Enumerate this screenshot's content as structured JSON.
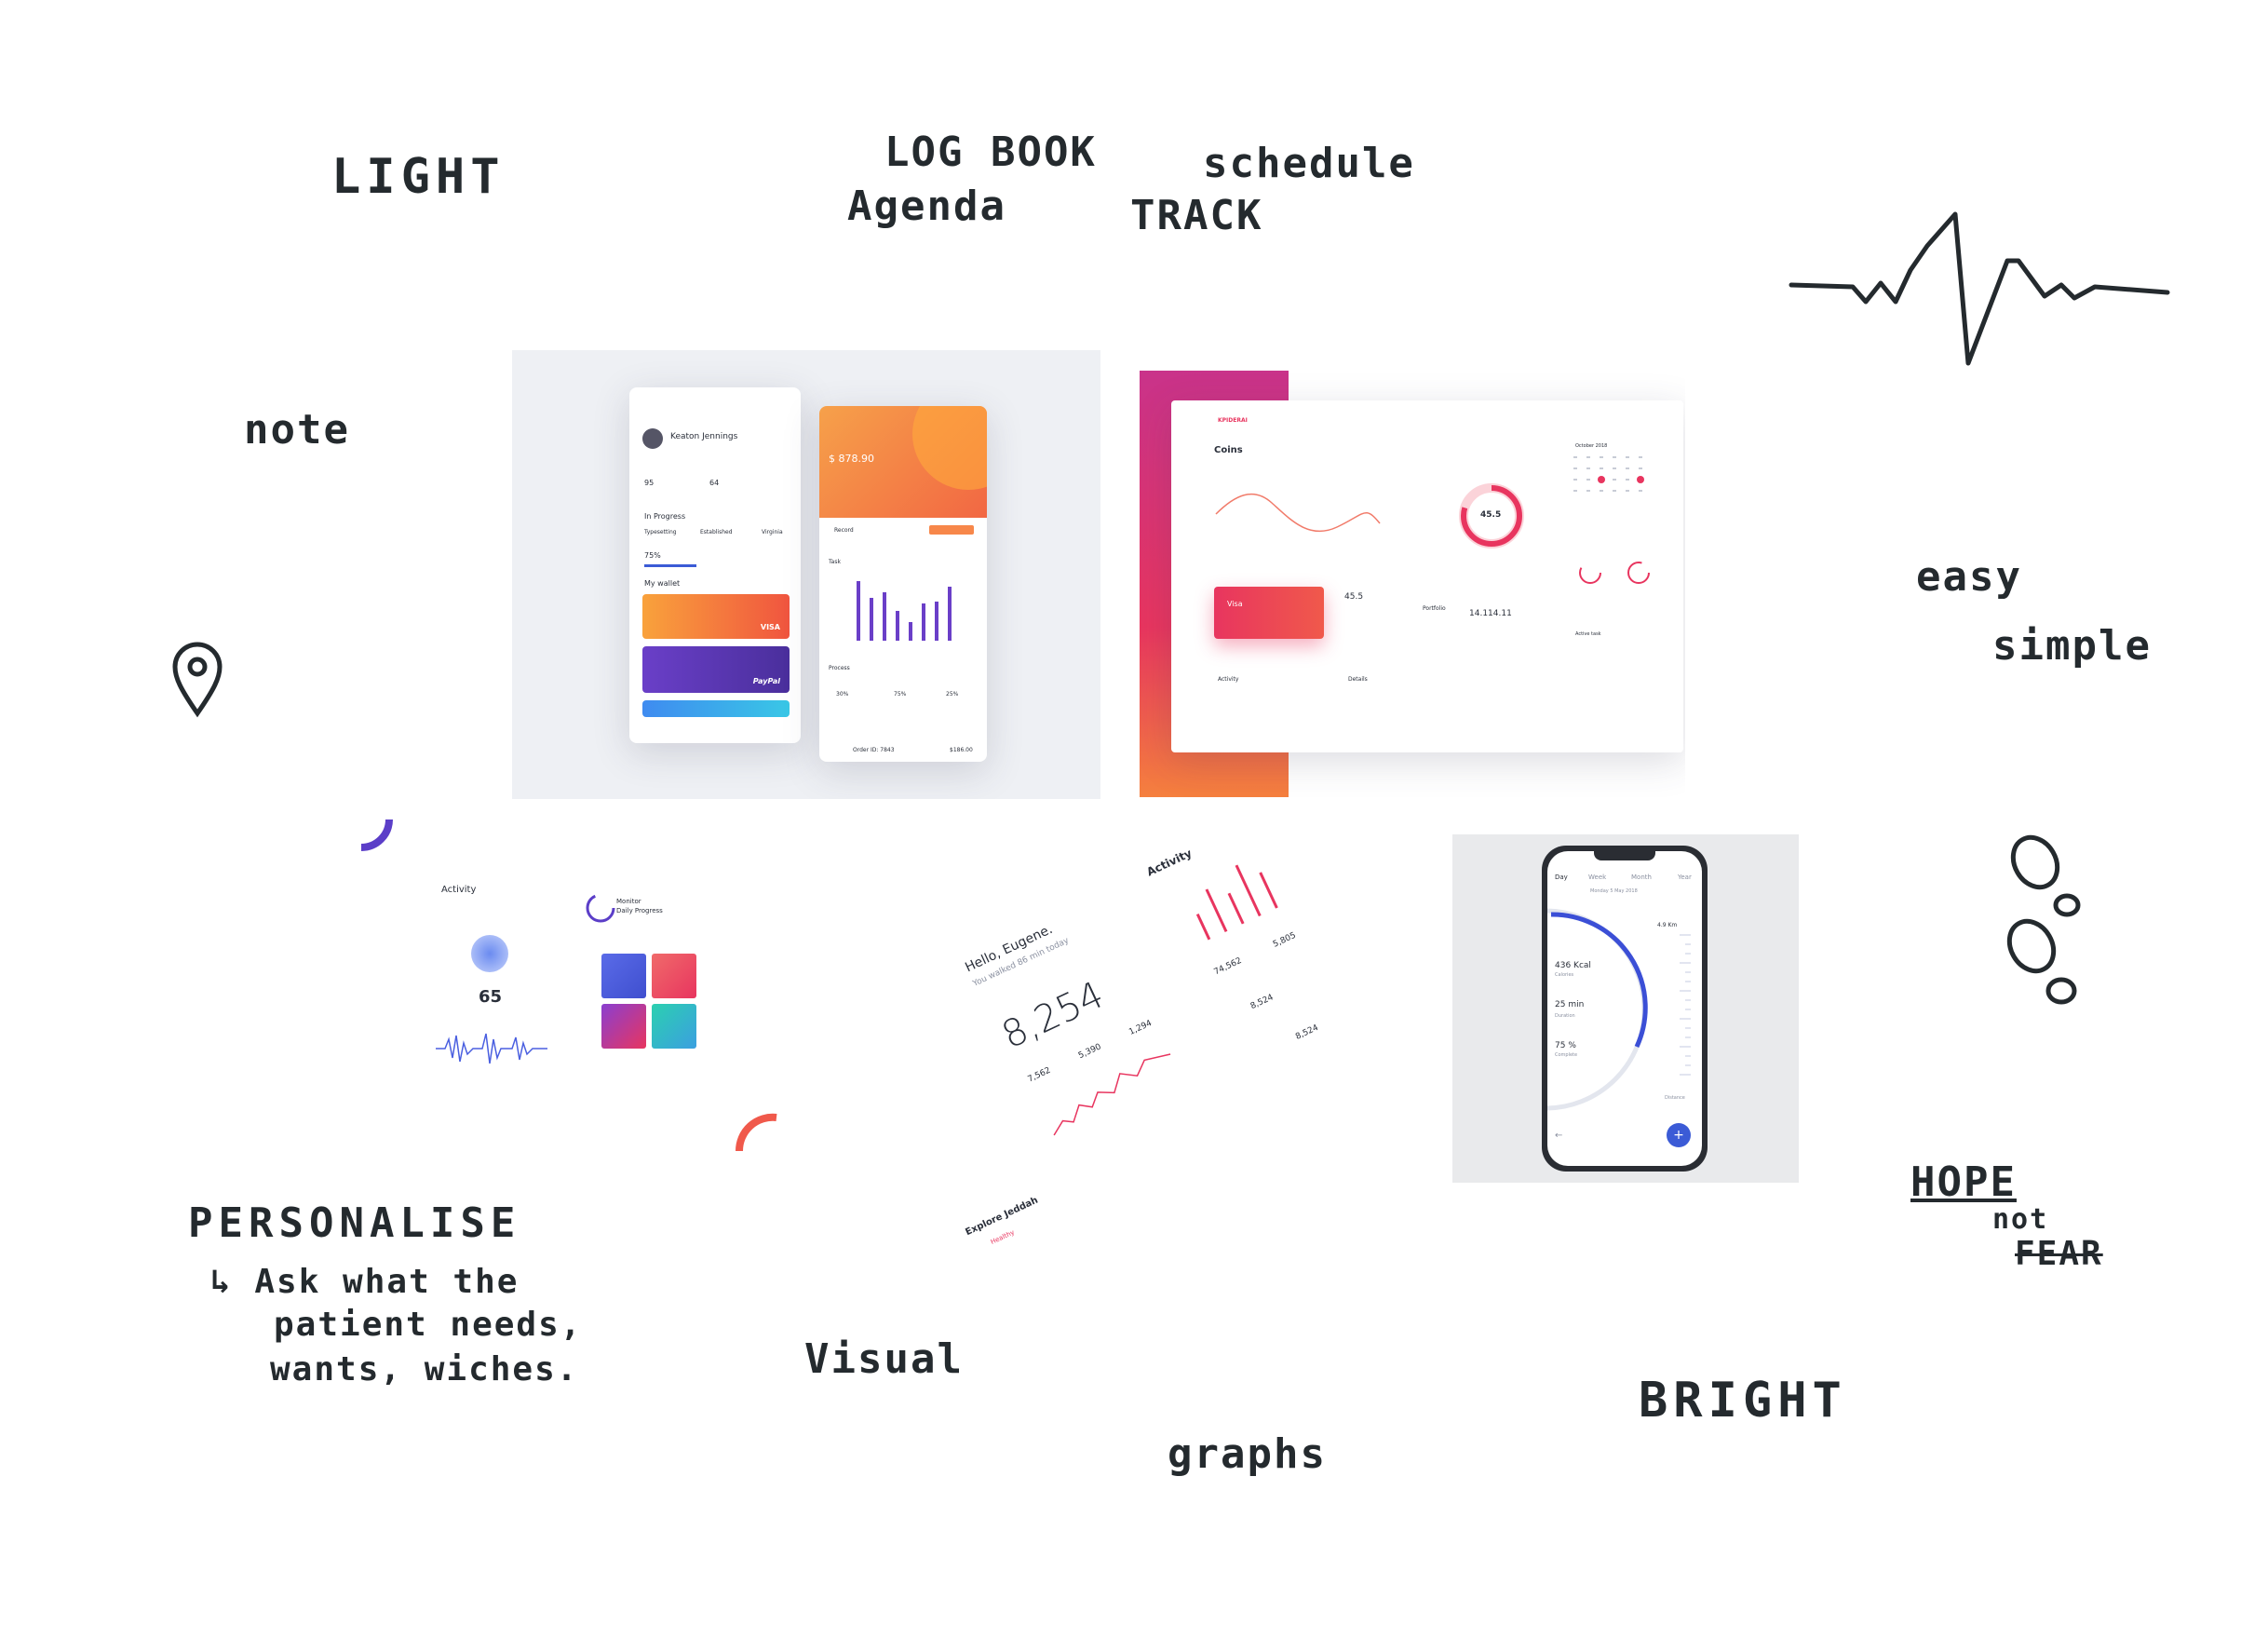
{
  "notes": {
    "light": "LIGHT",
    "log_book": "LOG BOOK",
    "schedule": "schedule",
    "agenda": "Agenda",
    "track": "TRACK",
    "note": "note",
    "easy": "easy",
    "simple": "simple",
    "personalise": "PERSONALISE",
    "ask_line1": "↳ Ask what the",
    "ask_line2": "patient needs,",
    "ask_line3": "wants, wiches.",
    "visual": "Visual",
    "graphs": "graphs",
    "bright": "BRIGHT",
    "hope": "HOPE",
    "not": "not",
    "fear": "FEAR"
  },
  "wallet_app": {
    "user_name": "Keaton Jennings",
    "stat_a": "95",
    "stat_b": "64",
    "in_progress": "In Progress",
    "tag_1": "Typesetting",
    "tag_2": "Established",
    "tag_3": "Virginia",
    "percent": "75%",
    "my_wallet": "My wallet",
    "visa": "VISA",
    "paypal": "PayPal",
    "balance": "$ 878.90",
    "record": "Record",
    "task": "Task",
    "process": "Process",
    "process_30": "30%",
    "process_75": "75%",
    "process_25": "25%",
    "order": "Order ID: 7843",
    "order_price": "$186.00"
  },
  "dashboard": {
    "brand": "KPIDERAI",
    "coins": "Coins",
    "gauge_value": "45.5",
    "small_value": "45.5",
    "big_amount": "14.114.11",
    "visa": "Visa",
    "calendar_month": "October 2018",
    "activity": "Activity",
    "details": "Details",
    "portfolio": "Portfolio",
    "active_task": "Active task"
  },
  "activity_app": {
    "activity": "Activity",
    "heart_value": "65",
    "monitor": "Monitor",
    "daily_progress": "Daily Progress"
  },
  "steps_app": {
    "greeting": "Hello, Eugene.",
    "walked": "You walked 86 min today",
    "steps": "8,254",
    "v1": "7,562",
    "v2": "5,390",
    "v3": "1,294",
    "activity": "Activity",
    "a1": "74,562",
    "a2": "5,805",
    "a3": "8,524",
    "a4": "8,524",
    "explore": "Explore Jeddah",
    "healthy": "Healthy"
  },
  "phone_app": {
    "tab_day": "Day",
    "tab_week": "Week",
    "tab_month": "Month",
    "tab_year": "Year",
    "date": "Monday 5 May 2018",
    "distance": "4.9 Km",
    "kcal": "436 Kcal",
    "kcal_label": "Calories",
    "duration": "25 min",
    "duration_label": "Duration",
    "complete": "75 %",
    "complete_label": "Complete",
    "distance_label": "Distance",
    "fab": "+"
  },
  "colors": {
    "ink": "#242a2e",
    "accent_orange": "#f5803e",
    "accent_pink": "#e8355f",
    "accent_purple": "#5b3ec8",
    "accent_blue": "#3b5bd6"
  }
}
